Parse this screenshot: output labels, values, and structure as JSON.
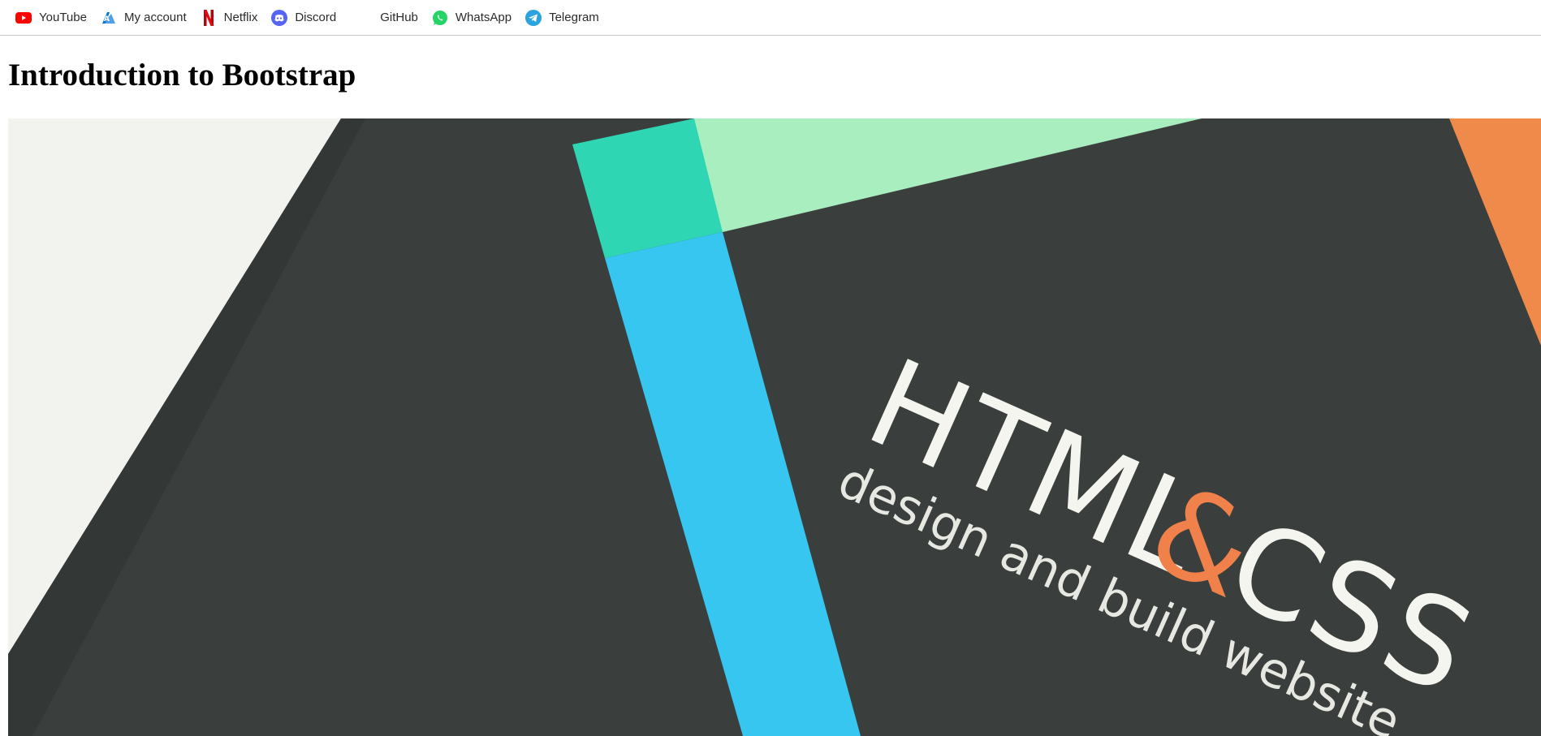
{
  "bookmarks": [
    {
      "label": "YouTube",
      "icon": "youtube-icon",
      "color": "#ff0000"
    },
    {
      "label": "My account",
      "icon": "azure-icon",
      "color": "#0078d4"
    },
    {
      "label": "Netflix",
      "icon": "netflix-icon",
      "color": "#e50914"
    },
    {
      "label": "Discord",
      "icon": "discord-icon",
      "color": "#5865f2"
    },
    {
      "label": "GitHub",
      "icon": "",
      "color": ""
    },
    {
      "label": "WhatsApp",
      "icon": "whatsapp-icon",
      "color": "#25d366"
    },
    {
      "label": "Telegram",
      "icon": "telegram-icon",
      "color": "#2aa3df"
    }
  ],
  "page": {
    "title": "Introduction to Bootstrap"
  },
  "hero": {
    "image_subject": "photo of an HTML & CSS book cover",
    "cover_title_part1": "HTML",
    "cover_ampersand": "&",
    "cover_title_part2": "CSS",
    "cover_subtitle": "design and build website",
    "colors": {
      "cover_background": "#3a3f3d",
      "stripe_teal": "#2fd6b4",
      "stripe_mint": "#a8eebf",
      "stripe_blue": "#36c6ef",
      "corner_orange": "#f08a4b",
      "ampersand_orange": "#f0814a",
      "paper_white": "#f2f2ef"
    }
  }
}
